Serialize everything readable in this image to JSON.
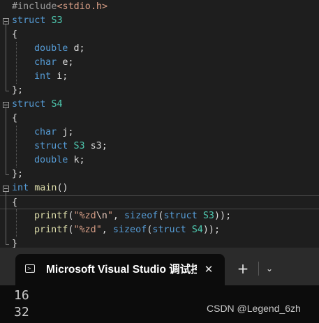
{
  "editor": {
    "lines": [
      {
        "kind": "include",
        "directive": "#include",
        "header": "<stdio.h>"
      },
      {
        "kind": "struct",
        "keyword": "struct",
        "name": "S3"
      },
      {
        "kind": "brace",
        "text": "{"
      },
      {
        "kind": "member",
        "type": "double",
        "name": "d;"
      },
      {
        "kind": "member",
        "type": "char",
        "name": "e;"
      },
      {
        "kind": "member",
        "type": "int",
        "name": "i;"
      },
      {
        "kind": "brace",
        "text": "};"
      },
      {
        "kind": "struct",
        "keyword": "struct",
        "name": "S4"
      },
      {
        "kind": "brace",
        "text": "{"
      },
      {
        "kind": "member",
        "type": "char",
        "name": "j;"
      },
      {
        "kind": "member_struct",
        "keyword": "struct",
        "type": "S3",
        "name": "s3;"
      },
      {
        "kind": "member",
        "type": "double",
        "name": "k;"
      },
      {
        "kind": "brace",
        "text": "};"
      },
      {
        "kind": "func",
        "ret": "int",
        "name": "main",
        "params": "()"
      },
      {
        "kind": "brace",
        "text": "{"
      },
      {
        "kind": "printf",
        "fn": "printf",
        "fmt_open": "\"%zd",
        "escape": "\\n",
        "fmt_close": "\"",
        "sizeof": "sizeof",
        "keyword": "struct",
        "type": "S3",
        "end": "));"
      },
      {
        "kind": "printf",
        "fn": "printf",
        "fmt_open": "\"%zd",
        "escape": "",
        "fmt_close": "\"",
        "sizeof": "sizeof",
        "keyword": "struct",
        "type": "S4",
        "end": "));"
      },
      {
        "kind": "brace",
        "text": "}"
      }
    ]
  },
  "terminal": {
    "tab_title": "Microsoft Visual Studio 调试控制台",
    "close_symbol": "✕",
    "new_tab_symbol": "+",
    "dropdown_symbol": "⌄",
    "output": [
      "16",
      "32"
    ]
  },
  "watermark": "CSDN @Legend_6zh",
  "colors": {
    "editor_background": "#1e1e1e",
    "keyword": "#569cd6",
    "string": "#d69d85",
    "terminal_background": "#0c0c0c",
    "terminal_titlebar": "#2b2b2b"
  }
}
